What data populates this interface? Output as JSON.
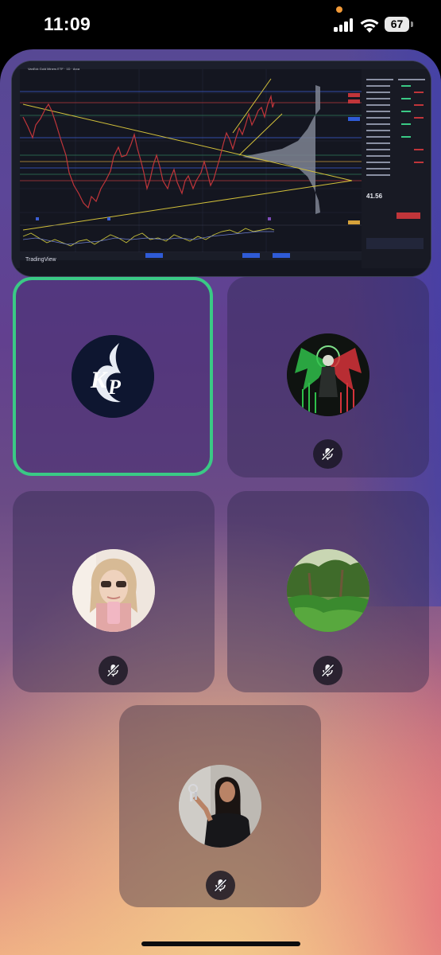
{
  "status_bar": {
    "time": "11:09",
    "battery": "67"
  },
  "screen_share": {
    "platform_label": "TradingView",
    "symbol_title": "VanEck Gold Miners ETF · 1D · Arca",
    "last_price": "41.56",
    "colors": {
      "price_line": "#c0353a",
      "trend_line": "#d6c23b",
      "volume_profile": "#9aa0ad",
      "indicator": "#c8c23b"
    }
  },
  "participants": [
    {
      "name_icon": "kp-logo-avatar",
      "active_speaker": true,
      "muted": false
    },
    {
      "name_icon": "angel-skeleton-avatar",
      "active_speaker": false,
      "muted": true
    },
    {
      "name_icon": "woman-sunglasses-avatar",
      "active_speaker": false,
      "muted": true
    },
    {
      "name_icon": "palm-trees-avatar",
      "active_speaker": false,
      "muted": true
    },
    {
      "name_icon": "woman-holding-keys-avatar",
      "active_speaker": false,
      "muted": true
    }
  ],
  "colors": {
    "active_border": "#3ac985",
    "tile_background": "#30284e",
    "mute_button": "#181622"
  }
}
